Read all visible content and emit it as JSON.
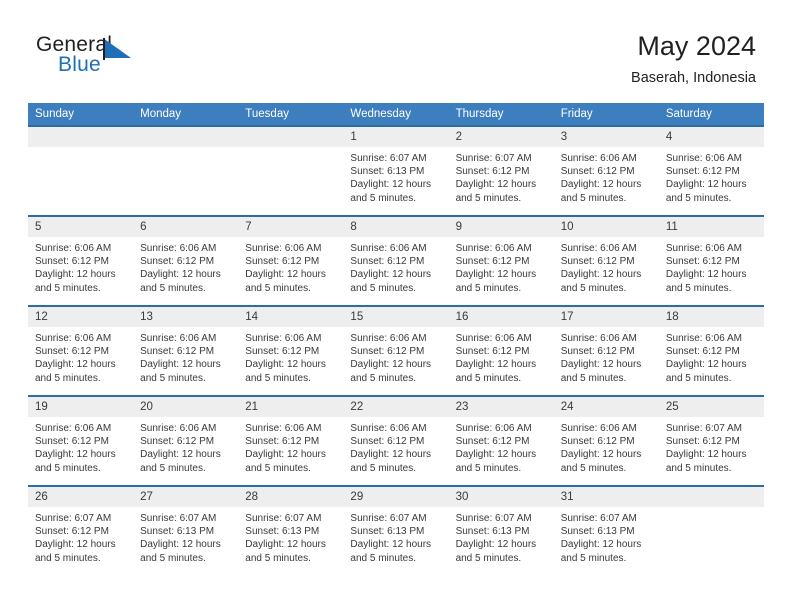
{
  "brand": {
    "word_one": "General",
    "word_two": "Blue",
    "flag_icon": "blue-triangle-flag-icon",
    "colors": {
      "dark": "#231f20",
      "blue": "#1d6fb8"
    }
  },
  "header": {
    "title": "May 2024",
    "subtitle": "Baserah, Indonesia"
  },
  "theme": {
    "header_blue": "#3d7ebf",
    "row_divider_blue": "#2e6da4",
    "date_band_gray": "#eeeeee",
    "text_dark": "#3a3a3a"
  },
  "weekday_headers": [
    "Sunday",
    "Monday",
    "Tuesday",
    "Wednesday",
    "Thursday",
    "Friday",
    "Saturday"
  ],
  "weeks": [
    [
      {
        "day": "",
        "sunrise": "",
        "sunset": "",
        "daylight": "",
        "empty": true
      },
      {
        "day": "",
        "sunrise": "",
        "sunset": "",
        "daylight": "",
        "empty": true
      },
      {
        "day": "",
        "sunrise": "",
        "sunset": "",
        "daylight": "",
        "empty": true
      },
      {
        "day": "1",
        "sunrise": "Sunrise: 6:07 AM",
        "sunset": "Sunset: 6:13 PM",
        "daylight": "Daylight: 12 hours and 5 minutes."
      },
      {
        "day": "2",
        "sunrise": "Sunrise: 6:07 AM",
        "sunset": "Sunset: 6:12 PM",
        "daylight": "Daylight: 12 hours and 5 minutes."
      },
      {
        "day": "3",
        "sunrise": "Sunrise: 6:06 AM",
        "sunset": "Sunset: 6:12 PM",
        "daylight": "Daylight: 12 hours and 5 minutes."
      },
      {
        "day": "4",
        "sunrise": "Sunrise: 6:06 AM",
        "sunset": "Sunset: 6:12 PM",
        "daylight": "Daylight: 12 hours and 5 minutes."
      }
    ],
    [
      {
        "day": "5",
        "sunrise": "Sunrise: 6:06 AM",
        "sunset": "Sunset: 6:12 PM",
        "daylight": "Daylight: 12 hours and 5 minutes."
      },
      {
        "day": "6",
        "sunrise": "Sunrise: 6:06 AM",
        "sunset": "Sunset: 6:12 PM",
        "daylight": "Daylight: 12 hours and 5 minutes."
      },
      {
        "day": "7",
        "sunrise": "Sunrise: 6:06 AM",
        "sunset": "Sunset: 6:12 PM",
        "daylight": "Daylight: 12 hours and 5 minutes."
      },
      {
        "day": "8",
        "sunrise": "Sunrise: 6:06 AM",
        "sunset": "Sunset: 6:12 PM",
        "daylight": "Daylight: 12 hours and 5 minutes."
      },
      {
        "day": "9",
        "sunrise": "Sunrise: 6:06 AM",
        "sunset": "Sunset: 6:12 PM",
        "daylight": "Daylight: 12 hours and 5 minutes."
      },
      {
        "day": "10",
        "sunrise": "Sunrise: 6:06 AM",
        "sunset": "Sunset: 6:12 PM",
        "daylight": "Daylight: 12 hours and 5 minutes."
      },
      {
        "day": "11",
        "sunrise": "Sunrise: 6:06 AM",
        "sunset": "Sunset: 6:12 PM",
        "daylight": "Daylight: 12 hours and 5 minutes."
      }
    ],
    [
      {
        "day": "12",
        "sunrise": "Sunrise: 6:06 AM",
        "sunset": "Sunset: 6:12 PM",
        "daylight": "Daylight: 12 hours and 5 minutes."
      },
      {
        "day": "13",
        "sunrise": "Sunrise: 6:06 AM",
        "sunset": "Sunset: 6:12 PM",
        "daylight": "Daylight: 12 hours and 5 minutes."
      },
      {
        "day": "14",
        "sunrise": "Sunrise: 6:06 AM",
        "sunset": "Sunset: 6:12 PM",
        "daylight": "Daylight: 12 hours and 5 minutes."
      },
      {
        "day": "15",
        "sunrise": "Sunrise: 6:06 AM",
        "sunset": "Sunset: 6:12 PM",
        "daylight": "Daylight: 12 hours and 5 minutes."
      },
      {
        "day": "16",
        "sunrise": "Sunrise: 6:06 AM",
        "sunset": "Sunset: 6:12 PM",
        "daylight": "Daylight: 12 hours and 5 minutes."
      },
      {
        "day": "17",
        "sunrise": "Sunrise: 6:06 AM",
        "sunset": "Sunset: 6:12 PM",
        "daylight": "Daylight: 12 hours and 5 minutes."
      },
      {
        "day": "18",
        "sunrise": "Sunrise: 6:06 AM",
        "sunset": "Sunset: 6:12 PM",
        "daylight": "Daylight: 12 hours and 5 minutes."
      }
    ],
    [
      {
        "day": "19",
        "sunrise": "Sunrise: 6:06 AM",
        "sunset": "Sunset: 6:12 PM",
        "daylight": "Daylight: 12 hours and 5 minutes."
      },
      {
        "day": "20",
        "sunrise": "Sunrise: 6:06 AM",
        "sunset": "Sunset: 6:12 PM",
        "daylight": "Daylight: 12 hours and 5 minutes."
      },
      {
        "day": "21",
        "sunrise": "Sunrise: 6:06 AM",
        "sunset": "Sunset: 6:12 PM",
        "daylight": "Daylight: 12 hours and 5 minutes."
      },
      {
        "day": "22",
        "sunrise": "Sunrise: 6:06 AM",
        "sunset": "Sunset: 6:12 PM",
        "daylight": "Daylight: 12 hours and 5 minutes."
      },
      {
        "day": "23",
        "sunrise": "Sunrise: 6:06 AM",
        "sunset": "Sunset: 6:12 PM",
        "daylight": "Daylight: 12 hours and 5 minutes."
      },
      {
        "day": "24",
        "sunrise": "Sunrise: 6:06 AM",
        "sunset": "Sunset: 6:12 PM",
        "daylight": "Daylight: 12 hours and 5 minutes."
      },
      {
        "day": "25",
        "sunrise": "Sunrise: 6:07 AM",
        "sunset": "Sunset: 6:12 PM",
        "daylight": "Daylight: 12 hours and 5 minutes."
      }
    ],
    [
      {
        "day": "26",
        "sunrise": "Sunrise: 6:07 AM",
        "sunset": "Sunset: 6:12 PM",
        "daylight": "Daylight: 12 hours and 5 minutes."
      },
      {
        "day": "27",
        "sunrise": "Sunrise: 6:07 AM",
        "sunset": "Sunset: 6:13 PM",
        "daylight": "Daylight: 12 hours and 5 minutes."
      },
      {
        "day": "28",
        "sunrise": "Sunrise: 6:07 AM",
        "sunset": "Sunset: 6:13 PM",
        "daylight": "Daylight: 12 hours and 5 minutes."
      },
      {
        "day": "29",
        "sunrise": "Sunrise: 6:07 AM",
        "sunset": "Sunset: 6:13 PM",
        "daylight": "Daylight: 12 hours and 5 minutes."
      },
      {
        "day": "30",
        "sunrise": "Sunrise: 6:07 AM",
        "sunset": "Sunset: 6:13 PM",
        "daylight": "Daylight: 12 hours and 5 minutes."
      },
      {
        "day": "31",
        "sunrise": "Sunrise: 6:07 AM",
        "sunset": "Sunset: 6:13 PM",
        "daylight": "Daylight: 12 hours and 5 minutes."
      },
      {
        "day": "",
        "sunrise": "",
        "sunset": "",
        "daylight": "",
        "empty": true
      }
    ]
  ]
}
